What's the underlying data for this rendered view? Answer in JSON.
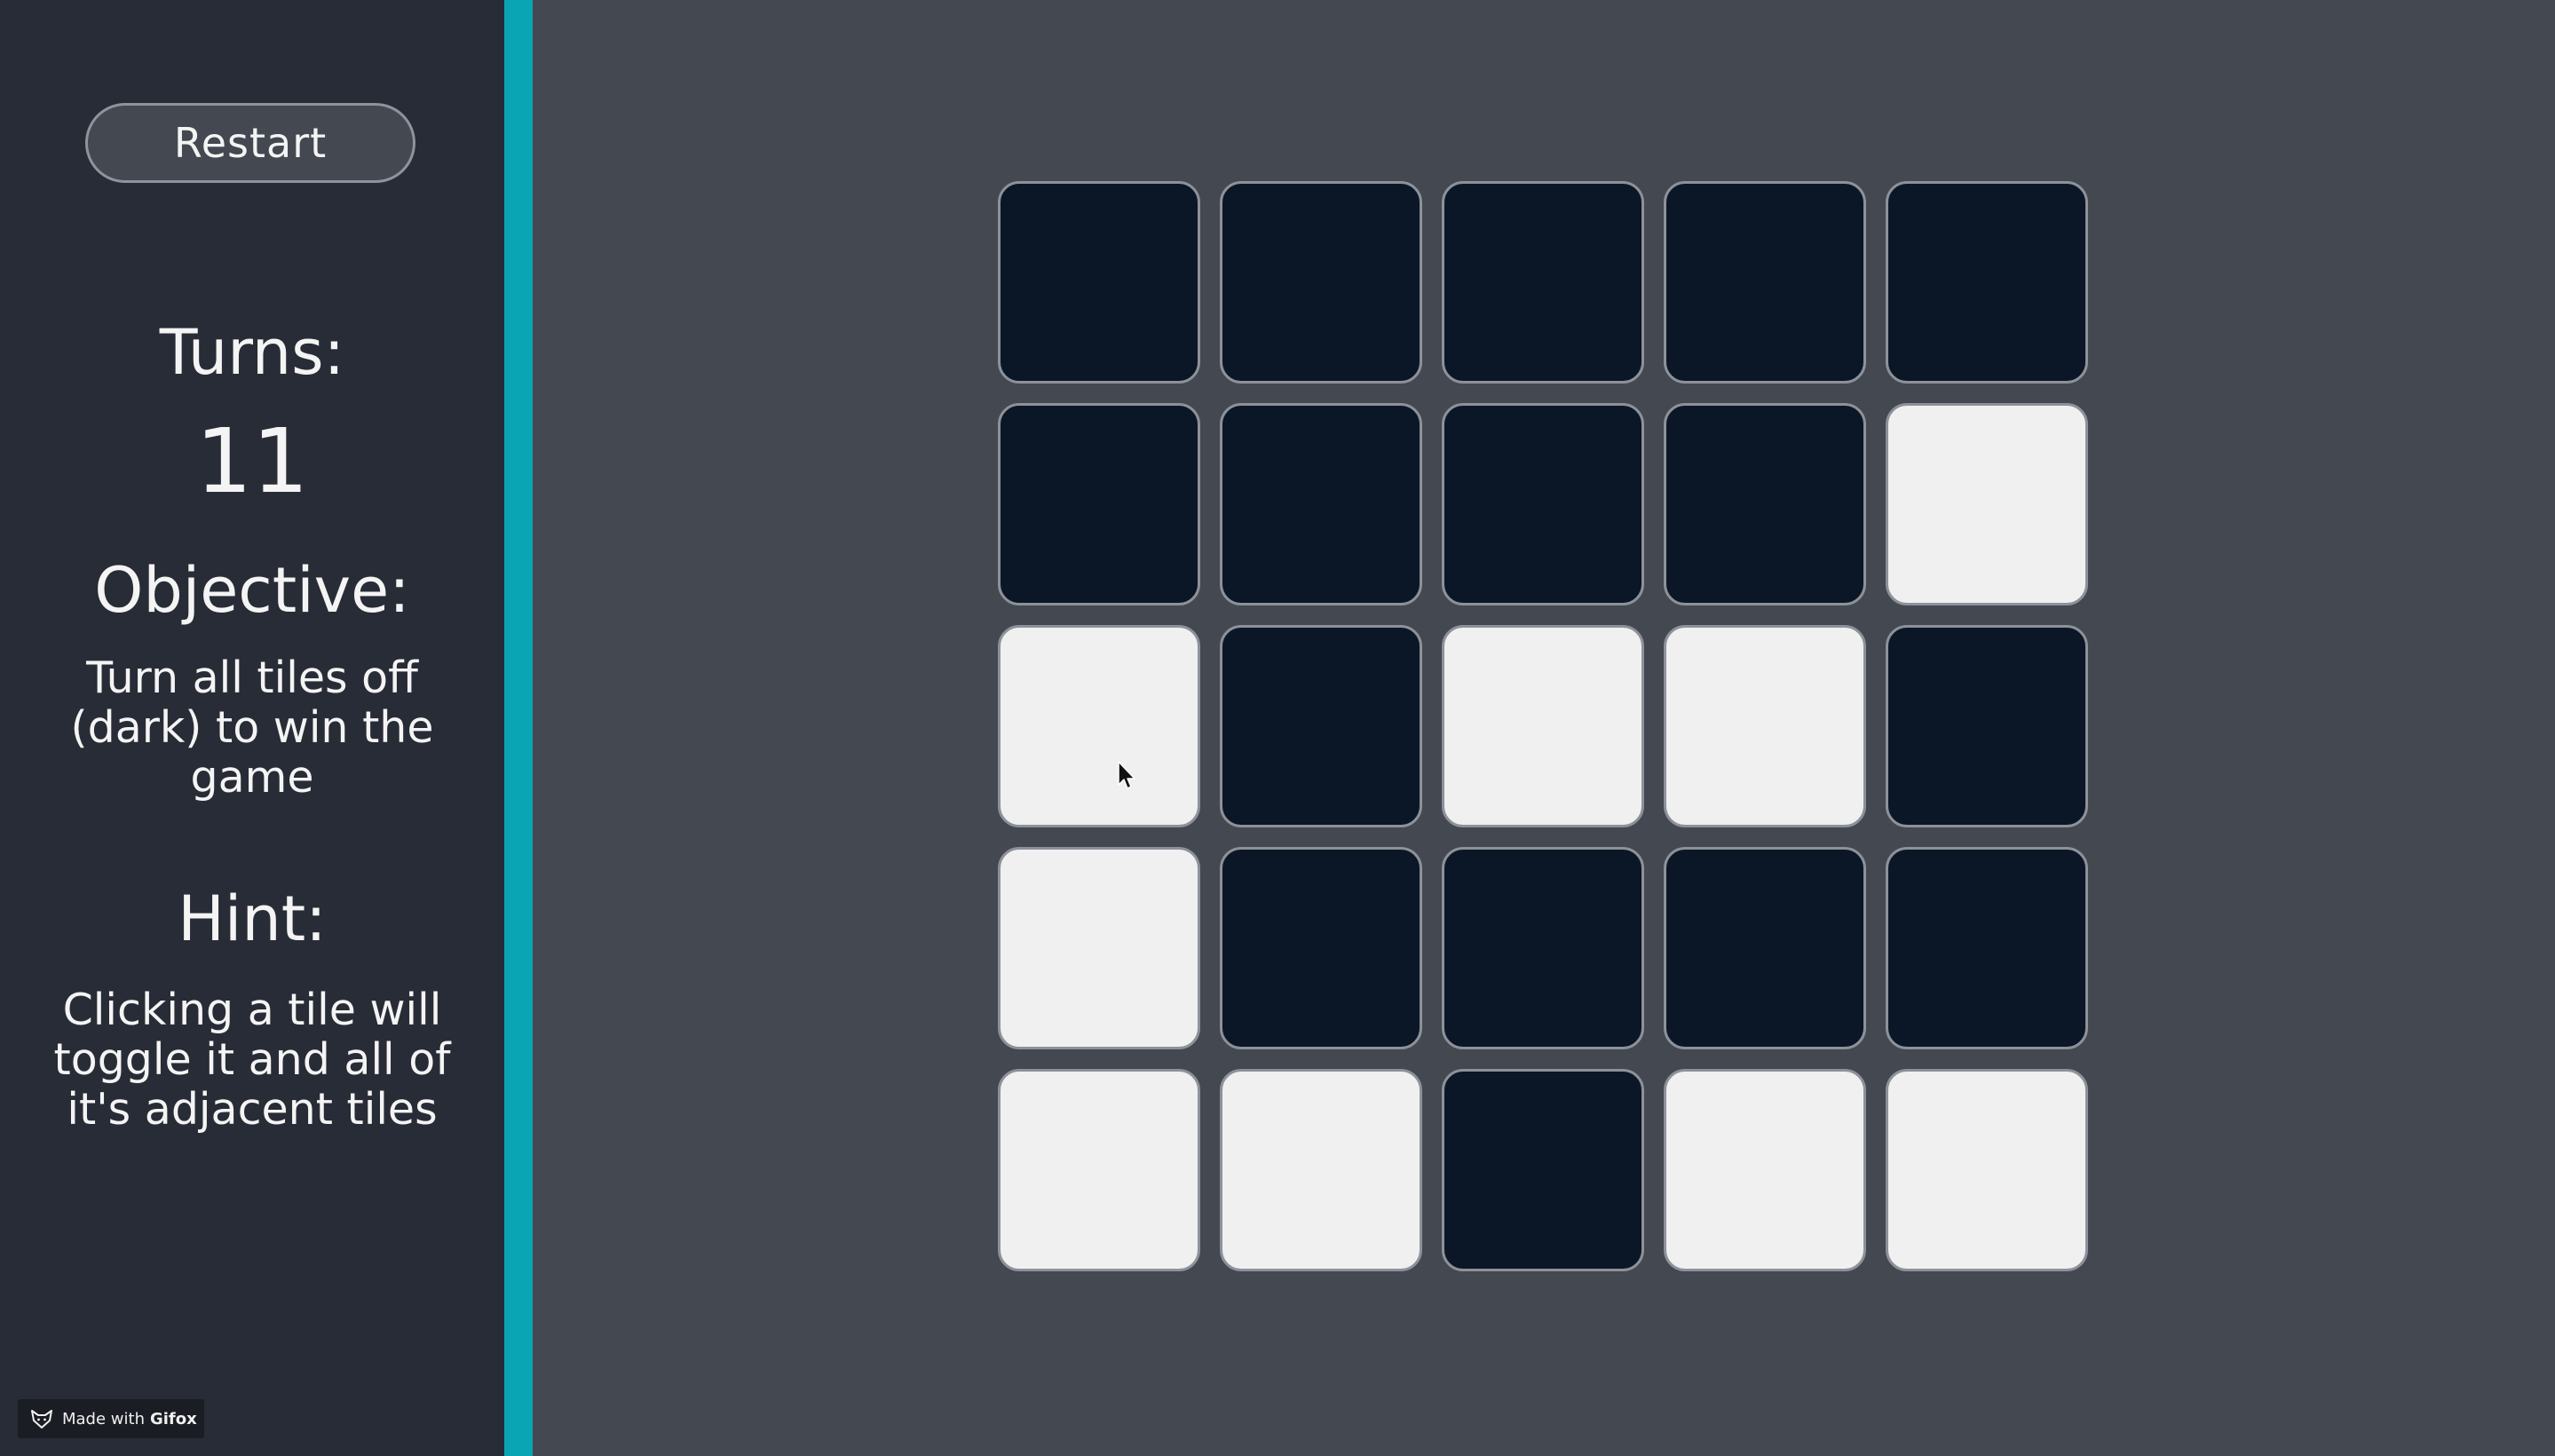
{
  "sidebar": {
    "restart_label": "Restart",
    "turns_label": "Turns:",
    "turns_value": "11",
    "objective_label": "Objective:",
    "objective_text": "Turn all tiles off (dark) to win the game",
    "hint_label": "Hint:",
    "hint_text": "Clicking a tile will toggle it and all of it's adjacent tiles"
  },
  "board": {
    "rows": 5,
    "cols": 5,
    "tiles": [
      [
        0,
        0,
        0,
        0,
        0
      ],
      [
        0,
        0,
        0,
        0,
        1
      ],
      [
        1,
        0,
        1,
        1,
        0
      ],
      [
        1,
        0,
        0,
        0,
        0
      ],
      [
        1,
        1,
        0,
        1,
        1
      ]
    ],
    "on_color": "#f0f0f0",
    "off_color": "#0b1726"
  },
  "badge": {
    "prefix": "Made with",
    "brand": "Gifox",
    "icon": "fox-icon"
  },
  "colors": {
    "accent": "#0aa5b5",
    "sidebar_bg": "#282c36",
    "main_bg": "#434851"
  }
}
